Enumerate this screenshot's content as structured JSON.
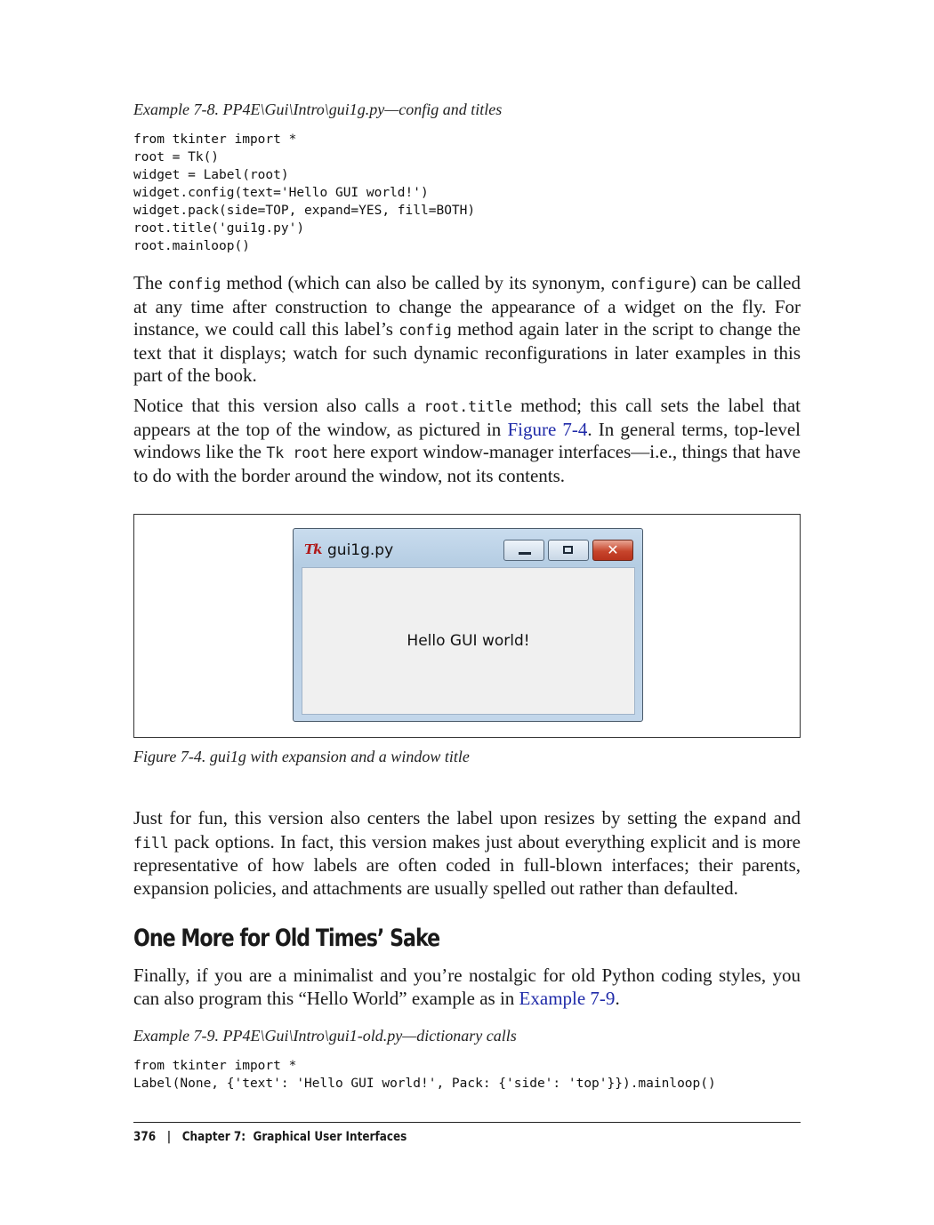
{
  "example_7_8": {
    "caption": "Example 7-8. PP4E\\Gui\\Intro\\gui1g.py—config and titles",
    "code": "from tkinter import *\nroot = Tk()\nwidget = Label(root)\nwidget.config(text='Hello GUI world!')\nwidget.pack(side=TOP, expand=YES, fill=BOTH)\nroot.title('gui1g.py')\nroot.mainloop()"
  },
  "para1": {
    "t1": "The ",
    "c1": "config",
    "t2": " method (which can also be called by its synonym, ",
    "c2": "configure",
    "t3": ") can be called at any time after construction to change the appearance of a widget on the fly. For instance, we could call this label’s ",
    "c3": "config",
    "t4": " method again later in the script to change the text that it displays; watch for such dynamic reconfigurations in later examples in this part of the book."
  },
  "para2": {
    "t1": "Notice that this version also calls a ",
    "c1": "root.title",
    "t2": " method; this call sets the label that appears at the top of the window, as pictured in ",
    "link": "Figure 7-4",
    "t3": ". In general terms, top-level windows like the ",
    "c2": "Tk root",
    "t4": " here export window-manager interfaces—i.e., things that have to do with the border around the window, not its contents."
  },
  "figure": {
    "window_title": "gui1g.py",
    "tk_logo": "Tk",
    "label_text": "Hello GUI world!",
    "min_icon": "minimize-icon",
    "max_icon": "maximize-icon",
    "close_glyph": "✕",
    "caption": "Figure 7-4. gui1g with expansion and a window title"
  },
  "para3": {
    "t1": "Just for fun, this version also centers the label upon resizes by setting the ",
    "c1": "expand",
    "t2": " and ",
    "c2": "fill",
    "t3": " pack options. In fact, this version makes just about everything explicit and is more representative of how labels are often coded in full-blown interfaces; their parents, expansion policies, and attachments are usually spelled out rather than defaulted."
  },
  "heading": "One More for Old Times’ Sake",
  "para4": {
    "t1": "Finally, if you are a minimalist and you’re nostalgic for old Python coding styles, you can also program this “Hello World” example as in ",
    "link": "Example 7-9",
    "t2": "."
  },
  "example_7_9": {
    "caption": "Example 7-9. PP4E\\Gui\\Intro\\gui1-old.py—dictionary calls",
    "code": "from tkinter import *\nLabel(None, {'text': 'Hello GUI world!', Pack: {'side': 'top'}}).mainloop()"
  },
  "footer": {
    "page_number": "376",
    "separator": "|",
    "chapter": "Chapter 7:  Graphical User Interfaces"
  }
}
